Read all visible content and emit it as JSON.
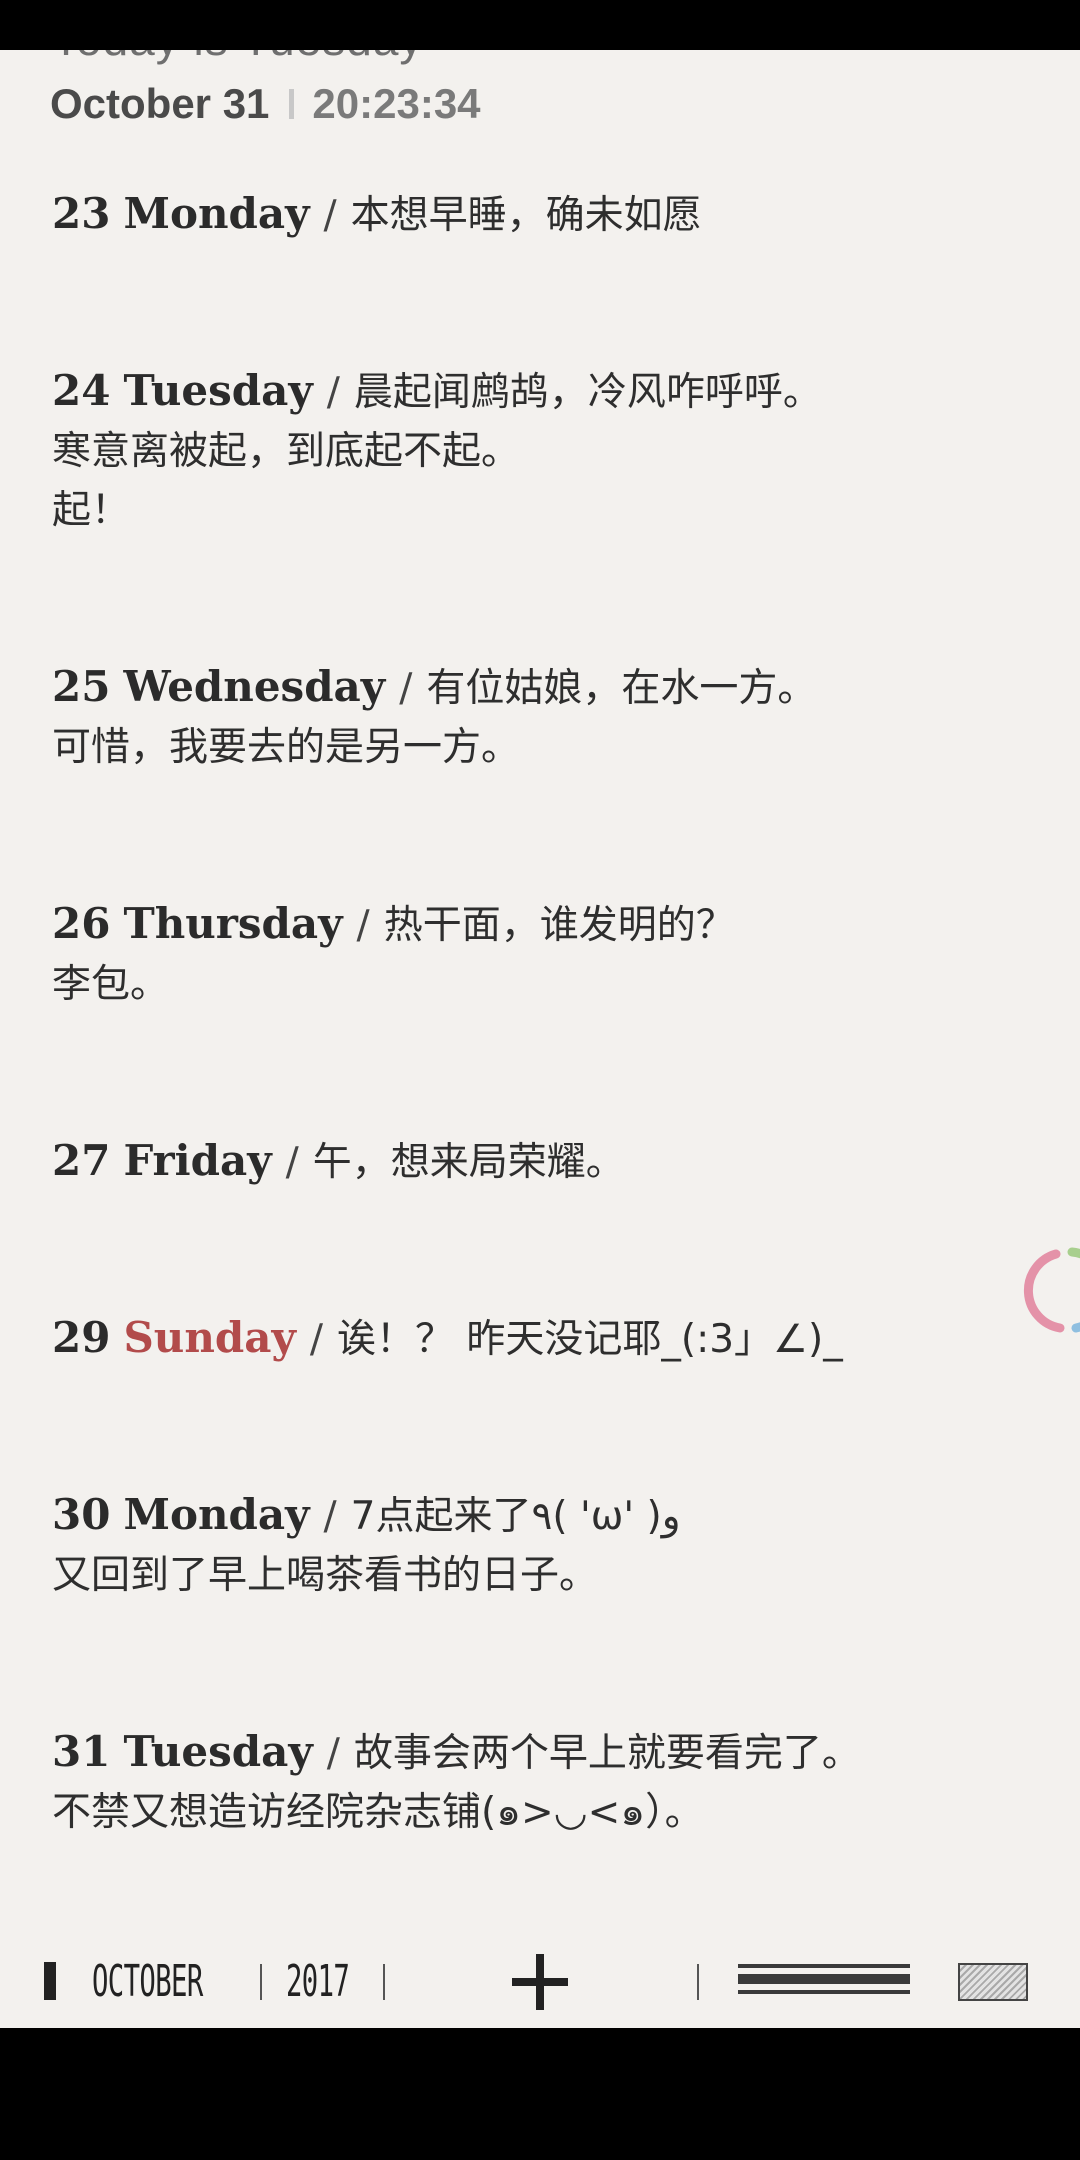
{
  "header": {
    "today_line": "Today is Tuesday",
    "date": "October 31",
    "time": "20:23:34"
  },
  "entries": [
    {
      "day": "23",
      "weekday": "Monday",
      "lines": [
        "本想早睡，确未如愿"
      ]
    },
    {
      "day": "24",
      "weekday": "Tuesday",
      "lines": [
        "晨起闻鹧鸪，冷风咋呼呼。",
        "寒意离被起，到底起不起。",
        "起！"
      ]
    },
    {
      "day": "25",
      "weekday": "Wednesday",
      "lines": [
        "有位姑娘，在水一方。",
        "可惜，我要去的是另一方。"
      ]
    },
    {
      "day": "26",
      "weekday": "Thursday",
      "lines": [
        "热干面，谁发明的？",
        "李包。"
      ]
    },
    {
      "day": "27",
      "weekday": "Friday",
      "lines": [
        "午，想来局荣耀。"
      ]
    },
    {
      "day": "29",
      "weekday": "Sunday",
      "lines": [
        "诶！？ 昨天没记耶_(:3」∠)_"
      ]
    },
    {
      "day": "30",
      "weekday": "Monday",
      "lines": [
        "7点起来了٩( 'ω' )و",
        "又回到了早上喝茶看书的日子。"
      ]
    },
    {
      "day": "31",
      "weekday": "Tuesday",
      "lines": [
        "故事会两个早上就要看完了。",
        "不禁又想造访经院杂志铺(๑>◡<๑）。"
      ]
    }
  ],
  "bottom_bar": {
    "month": "OCTOBER",
    "year": "2017",
    "add_icon": "plus-icon",
    "list_icon": "list-view-icon",
    "grid_icon": "grid-view-icon"
  },
  "colors": {
    "background": "#f3f1ee",
    "text": "#2e2e2e",
    "sunday_accent": "#b24b4b"
  }
}
